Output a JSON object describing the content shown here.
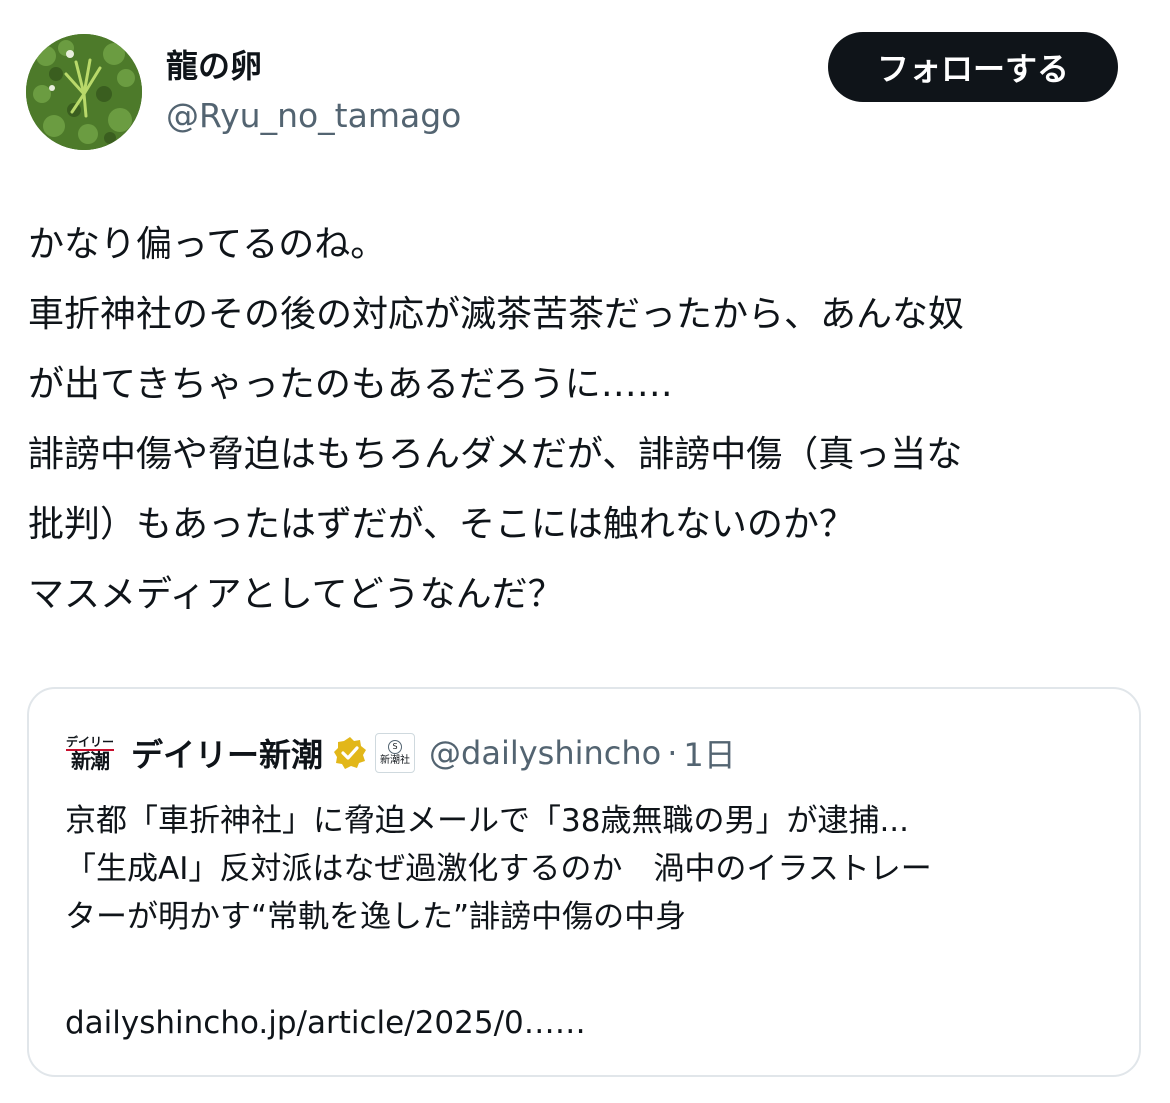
{
  "author": {
    "display_name": "龍の卵",
    "handle": "@Ryu_no_tamago",
    "avatar_icon": "avatar-photo-grass"
  },
  "follow_button": {
    "label": "フォローする"
  },
  "tweet": {
    "lines": [
      "かなり偏ってるのね。",
      "車折神社のその後の対応が滅茶苦茶だったから、あんな奴",
      "が出てきちゃったのもあるだろうに……",
      "誹謗中傷や脅迫はもちろんダメだが、誹謗中傷（真っ当な",
      "批判）もあったはずだが、そこには触れないのか？",
      "マスメディアとしてどうなんだ？"
    ]
  },
  "quote": {
    "logo_top": "デイリー",
    "logo_bottom": "新潮",
    "name": "デイリー新潮",
    "verified_icon": "verified-badge-gold",
    "affiliate_label": "新潮社",
    "handle": "@dailyshincho",
    "separator": "·",
    "time": "1日",
    "text_lines": [
      "京都「車折神社」に脅迫メールで「38歳無職の男」が逮捕...",
      "「生成AI」反対派はなぜ過激化するのか　渦中のイラストレー",
      "ターが明かす“常軌を逸した”誹謗中傷の中身"
    ],
    "link": "dailyshincho.jp/article/2025/0……"
  },
  "colors": {
    "text_primary": "#0f1419",
    "text_secondary": "#536471",
    "button_bg": "#0f1419",
    "card_border": "#e1e6ea",
    "verified_gold": "#e2b719"
  }
}
